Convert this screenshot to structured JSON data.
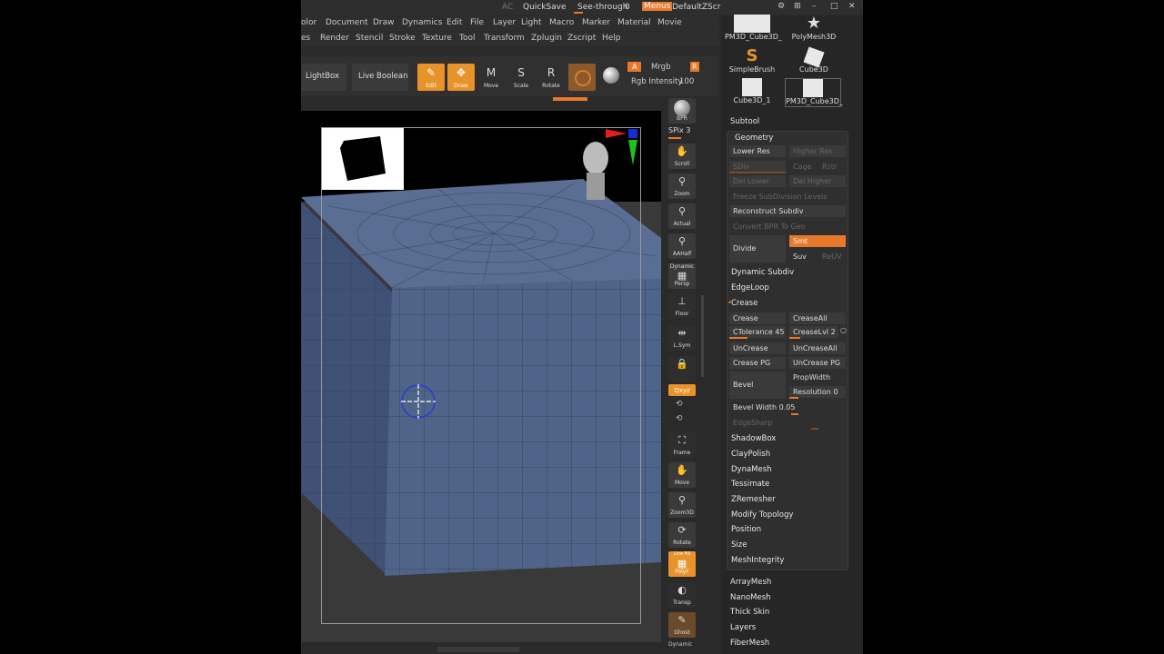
{
  "topbar": {
    "ac": "AC",
    "quicksave": "QuickSave",
    "seethrough": "See-through",
    "seethrough_value": "0",
    "menus": "Menus",
    "script": "DefaultZScript"
  },
  "menu_row1": [
    "olor",
    "Document",
    "Draw",
    "Dynamics",
    "Edit",
    "File",
    "Layer",
    "Light",
    "Macro",
    "Marker",
    "Material",
    "Movie"
  ],
  "menu_row2": [
    "es",
    "Render",
    "Stencil",
    "Stroke",
    "Texture",
    "Tool",
    "Transform",
    "Zplugin",
    "Zscript",
    "Help"
  ],
  "toolbar": {
    "lightbox": "LightBox",
    "liveboolean": "Live Boolean",
    "edit": "Edit",
    "draw": "Draw",
    "move": "Move",
    "scale": "Scale",
    "rotate": "Rotate",
    "a_label": "A",
    "mrgb": "Mrgb",
    "r_label": "R",
    "rgb_intensity_label": "Rgb Intensity",
    "rgb_intensity_value": "100"
  },
  "shelf": {
    "bpr": "BPR",
    "spix_label": "SPix",
    "spix_value": "3",
    "scroll": "Scroll",
    "zoom": "Zoom",
    "actual": "Actual",
    "aahalf": "AAHalf",
    "dynamic": "Dynamic",
    "persp": "Persp",
    "floor": "Floor",
    "lsym": "L.Sym",
    "qxyz": "Qxyz",
    "frame": "Frame",
    "move": "Move",
    "zoom3d": "Zoom3D",
    "rotate": "Rotate",
    "linefill": "Line Fill",
    "polyf": "PolyF",
    "transp": "Transp",
    "ghost": "Ghost",
    "dynamic2": "Dynamic"
  },
  "tools": [
    {
      "label": "PM3D_Cube3D_"
    },
    {
      "label": "PolyMesh3D"
    },
    {
      "label": "SimpleBrush"
    },
    {
      "label": "Cube3D"
    },
    {
      "label": "Cube3D_1"
    },
    {
      "label": "PM3D_Cube3D_"
    }
  ],
  "subtool": "Subtool",
  "geometry": {
    "title": "Geometry",
    "lower_res": "Lower Res",
    "higher_res": "Higher Res",
    "sdiv": "SDiv",
    "cage": "Cage",
    "rstr": "Rstr",
    "del_lower": "Del Lower",
    "del_higher": "Del Higher",
    "freeze": "Freeze SubDivision Levels",
    "reconstruct": "Reconstruct Subdiv",
    "convert": "Convert BPR To Geo",
    "divide": "Divide",
    "smt": "Smt",
    "suv": "Suv",
    "reuv": "ReUV",
    "dynamic_subdiv": "Dynamic Subdiv",
    "edgeloop": "EdgeLoop",
    "crease_header": "Crease",
    "crease": "Crease",
    "creaseall": "CreaseAll",
    "ctolerance_label": "CTolerance",
    "ctolerance_value": "45",
    "creaselvl_label": "CreaseLvl",
    "creaselvl_value": "2",
    "uncrease": "UnCrease",
    "uncreaseall": "UnCreaseAll",
    "crease_pg": "Crease PG",
    "uncrease_pg": "UnCrease PG",
    "bevel": "Bevel",
    "propwidth": "PropWidth",
    "resolution_label": "Resolution",
    "resolution_value": "0",
    "bevel_width_label": "Bevel Width",
    "bevel_width_value": "0.05",
    "edgesharp": "EdgeSharp",
    "shadowbox": "ShadowBox",
    "claypolish": "ClayPolish",
    "dynamesh": "DynaMesh",
    "tessimate": "Tessimate",
    "zremesher": "ZRemesher",
    "modify_topology": "Modify Topology",
    "position": "Position",
    "size": "Size",
    "meshintegrity": "MeshIntegrity"
  },
  "more": [
    "ArrayMesh",
    "NanoMesh",
    "Thick Skin",
    "Layers",
    "FiberMesh"
  ],
  "colors": {
    "accent": "#e8922a",
    "mesh": "#4f6488",
    "bg": "#2a2a2a"
  }
}
